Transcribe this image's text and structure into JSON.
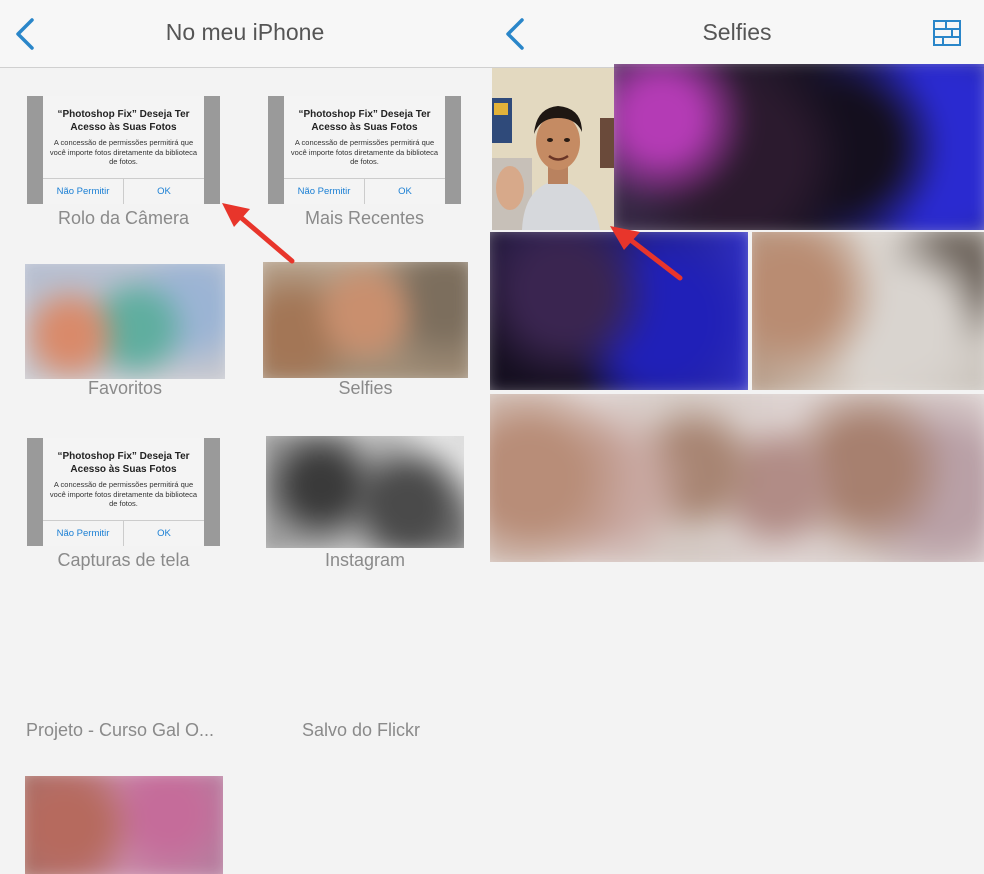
{
  "left": {
    "title": "No meu iPhone",
    "albums": [
      {
        "label": "Rolo da Câmera"
      },
      {
        "label": "Mais Recentes"
      },
      {
        "label": "Favoritos"
      },
      {
        "label": "Selfies"
      },
      {
        "label": "Capturas de tela"
      },
      {
        "label": "Instagram"
      },
      {
        "label": "Projeto - Curso Gal O..."
      },
      {
        "label": "Salvo do Flickr"
      }
    ],
    "permission_dialog": {
      "title": "“Photoshop Fix” Deseja Ter Acesso às Suas Fotos",
      "body": "A concessão de permissões permitirá que você importe fotos diretamente da biblioteca de fotos.",
      "deny_label": "Não Permitir",
      "ok_label": "OK"
    }
  },
  "right": {
    "title": "Selfies"
  },
  "colors": {
    "accent": "#2a86c9",
    "arrow": "#e8352b",
    "label": "#8a8a8a"
  },
  "icons": [
    "back-chevron-icon",
    "grid-layout-icon"
  ]
}
